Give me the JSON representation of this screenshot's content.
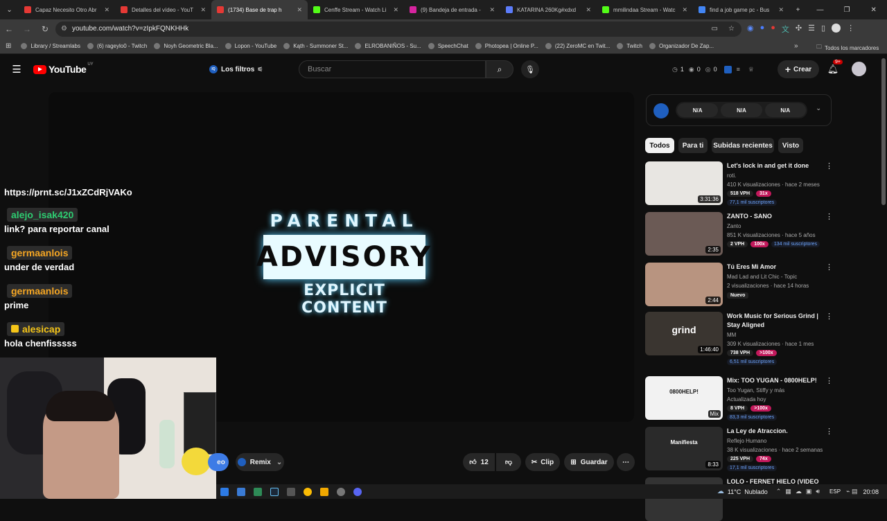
{
  "browser": {
    "tabs": [
      {
        "title": "Capaz Necesito Otro Abr",
        "color": "#e53935"
      },
      {
        "title": "Detalles del vídeo - YouT",
        "color": "#e53935"
      },
      {
        "title": "(1734) Base de trap h",
        "color": "#e53935"
      },
      {
        "title": "Cenffe Stream - Watch Li",
        "color": "#53fc18"
      },
      {
        "title": "(9) Bandeja de entrada -",
        "color": "#d6249f"
      },
      {
        "title": "KATARINA 260Kg#xdxd",
        "color": "#5c7cfa"
      },
      {
        "title": "mmilindaa Stream - Watc",
        "color": "#53fc18"
      },
      {
        "title": "find a job game pc - Bus",
        "color": "#4285f4"
      }
    ],
    "url": "youtube.com/watch?v=zIpkFQNKHHk",
    "bookmarks": [
      "Library / Streamlabs",
      "(6) rageylo0 - Twitch",
      "Noyh Geometric Bla...",
      "Lopon - YouTube",
      "Kąth - Summoner St...",
      "ELROBANIÑOS - Su...",
      "SpeechChat",
      "Photopea | Online P...",
      "(22) ZeroMC en Twit...",
      "Twitch",
      "Organizador De Zap..."
    ],
    "all_bookmarks": "Todos los marcadores"
  },
  "youtube": {
    "logo": "YouTube",
    "region": "UY",
    "filters_label": "Los filtros",
    "search_placeholder": "Buscar",
    "stats": [
      "1",
      "0",
      "0"
    ],
    "create_label": "Crear",
    "notif_badge": "9+"
  },
  "player": {
    "advisory_top": "PARENTAL",
    "advisory_mid": "ADVISORY",
    "advisory_bottom": "EXPLICIT CONTENT"
  },
  "chat": {
    "cut_line": "https://prnt.sc/J1xZCdRjVAKo",
    "messages": [
      {
        "user": "alejo_isak420",
        "text": "link? para reportar canal",
        "color": "#2ecc71"
      },
      {
        "user": "germaanlois",
        "text": "under de verdad",
        "color": "#f5a623"
      },
      {
        "user": "germaanlois",
        "text": "prime",
        "color": "#f5a623"
      },
      {
        "user": "alesicap",
        "text": "hola chenfisssss",
        "color": "#f5c518"
      }
    ]
  },
  "actions": {
    "cut_label": "eo",
    "remix": "Remix",
    "likes": "12",
    "clip": "Clip",
    "save": "Guardar"
  },
  "sidebar": {
    "na": [
      "N/A",
      "N/A",
      "N/A"
    ],
    "chips": [
      "Todos",
      "Para ti",
      "Subidas recientes",
      "Visto"
    ],
    "videos": [
      {
        "title": "Let's lock in and get it done",
        "channel": "roti.",
        "meta": "410 K visualizaciones · hace 2 meses",
        "duration": "3:31:36",
        "vph": "518 VPH",
        "mult": "31x",
        "subs": "77,1 mil suscriptores",
        "thumb": "#e8e6e2"
      },
      {
        "title": "ZANTO - SANO",
        "channel": "Zanto",
        "meta": "851 K visualizaciones · hace 5 años",
        "duration": "2:35",
        "vph": "2 VPH",
        "mult": "100x",
        "subs": "134 mil suscriptores",
        "thumb": "#6b5a55"
      },
      {
        "title": "Tú Eres Mi Amor",
        "channel": "Mad Lad and Lit Chic - Topic",
        "meta": "2 visualizaciones · hace 14 horas",
        "duration": "2:44",
        "badge": "Nuevo",
        "thumb": "#b89480"
      },
      {
        "title": "Work Music for Serious Grind | Stay Aligned",
        "channel": "MM",
        "meta": "309 K visualizaciones · hace 1 mes",
        "duration": "1:46:40",
        "vph": "738 VPH",
        "mult": ">100x",
        "subs": "6,51 mil suscriptores",
        "thumb": "#3a3530",
        "overlay": "grind"
      },
      {
        "title": "Mix: TOO YUGAN - 0800HELP!",
        "channel": "Too Yugan, Stiffy y más",
        "meta": "Actualizada hoy",
        "duration": "Mix",
        "vph": "8 VPH",
        "mult": ">100x",
        "subs": "83,3 mil suscriptores",
        "thumb": "#f2f2f2",
        "overlay": "0800HELP!"
      },
      {
        "title": "La Ley de Atraccion.",
        "channel": "Reflejo Humano",
        "meta": "38 K visualizaciones · hace 2 semanas",
        "duration": "8:33",
        "vph": "225 VPH",
        "mult": "74x",
        "subs": "17,1 mil suscriptores",
        "thumb": "#2a2a2a",
        "overlay": "Manifiesta"
      },
      {
        "title": "LOLO - FERNET HIELO (VIDEO",
        "channel": "",
        "meta": "",
        "duration": "",
        "thumb": "#333"
      }
    ]
  },
  "taskbar": {
    "temp": "11°C",
    "weather": "Nublado",
    "lang": "ESP",
    "time": "20:08"
  }
}
